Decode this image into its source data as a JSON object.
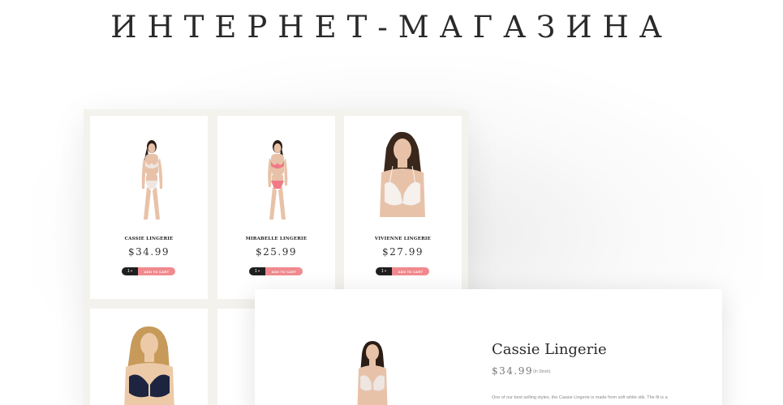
{
  "headline": {
    "text": "ИНТЕРНЕТ-МАГАЗИНА"
  },
  "products": [
    {
      "name": "CASSIE LINGERIE",
      "price": "$34.99",
      "cart_qty": "1",
      "add_label": "ADD TO CART",
      "set_color": "#efe6e2",
      "hair": "#2b1d16"
    },
    {
      "name": "MIRABELLE LINGERIE",
      "price": "$25.99",
      "cart_qty": "1",
      "add_label": "ADD TO CART",
      "set_color": "#f07a86",
      "hair": "#2b1d16"
    },
    {
      "name": "VIVIENNE LINGERIE",
      "price": "$27.99",
      "cart_qty": "1",
      "add_label": "ADD TO CART",
      "set_color": "#f7f1ee",
      "hair": "#3a271c"
    },
    {
      "name": "",
      "price": "",
      "set_color": "#1d2440",
      "hair": "#c79a5a"
    }
  ],
  "detail": {
    "title": "Cassie Lingerie",
    "price": "$34.99",
    "stock": "(In Stock)",
    "description": "One of our best selling styles, the Cassie Lingerie is made from soft white silk. The fit is a moulded cup for shape creating a perfect silhouette, and"
  },
  "colors": {
    "accent": "#f08a8e",
    "dark": "#1f1f1f",
    "panel_bg": "#f3f2ed"
  }
}
